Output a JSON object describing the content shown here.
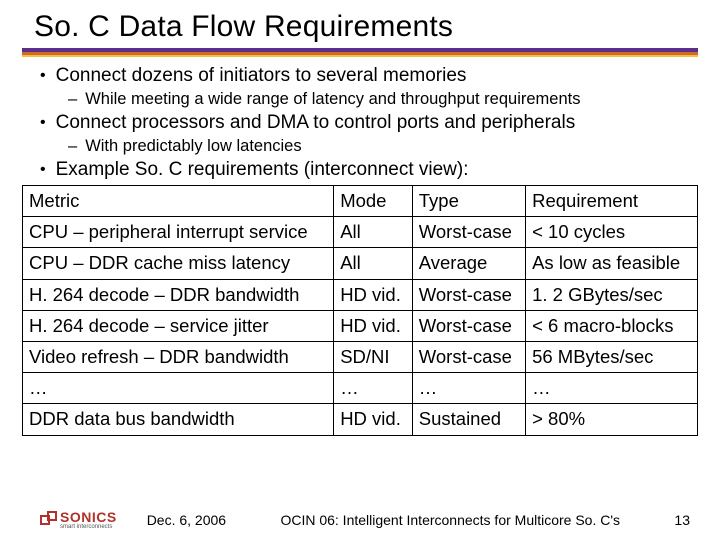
{
  "title": "So. C Data Flow Requirements",
  "bullets": {
    "b1": "Connect dozens of initiators to several memories",
    "b1s1": "While meeting a wide range of latency and throughput requirements",
    "b2": "Connect processors and DMA to control ports and peripherals",
    "b2s1": "With predictably low latencies",
    "b3": "Example So. C requirements (interconnect view):"
  },
  "table": {
    "headers": {
      "c0": "Metric",
      "c1": "Mode",
      "c2": "Type",
      "c3": "Requirement"
    },
    "rows": [
      {
        "c0": "CPU – peripheral interrupt service",
        "c1": "All",
        "c2": "Worst-case",
        "c3": "< 10 cycles"
      },
      {
        "c0": "CPU – DDR cache miss latency",
        "c1": "All",
        "c2": "Average",
        "c3": "As low as feasible"
      },
      {
        "c0": "H. 264 decode – DDR bandwidth",
        "c1": "HD vid.",
        "c2": "Worst-case",
        "c3": "1. 2 GBytes/sec"
      },
      {
        "c0": "H. 264 decode – service jitter",
        "c1": "HD vid.",
        "c2": "Worst-case",
        "c3": "< 6 macro-blocks"
      },
      {
        "c0": "Video refresh – DDR bandwidth",
        "c1": "SD/NI",
        "c2": "Worst-case",
        "c3": "56 MBytes/sec"
      },
      {
        "c0": "…",
        "c1": "…",
        "c2": "…",
        "c3": "…"
      },
      {
        "c0": "DDR data bus bandwidth",
        "c1": "HD vid.",
        "c2": "Sustained",
        "c3": "> 80%"
      }
    ]
  },
  "footer": {
    "logo_text": "SONICS",
    "logo_sub": "smart interconnects",
    "date": "Dec. 6, 2006",
    "caption": "OCIN 06: Intelligent Interconnects for Multicore So. C's",
    "page": "13"
  }
}
